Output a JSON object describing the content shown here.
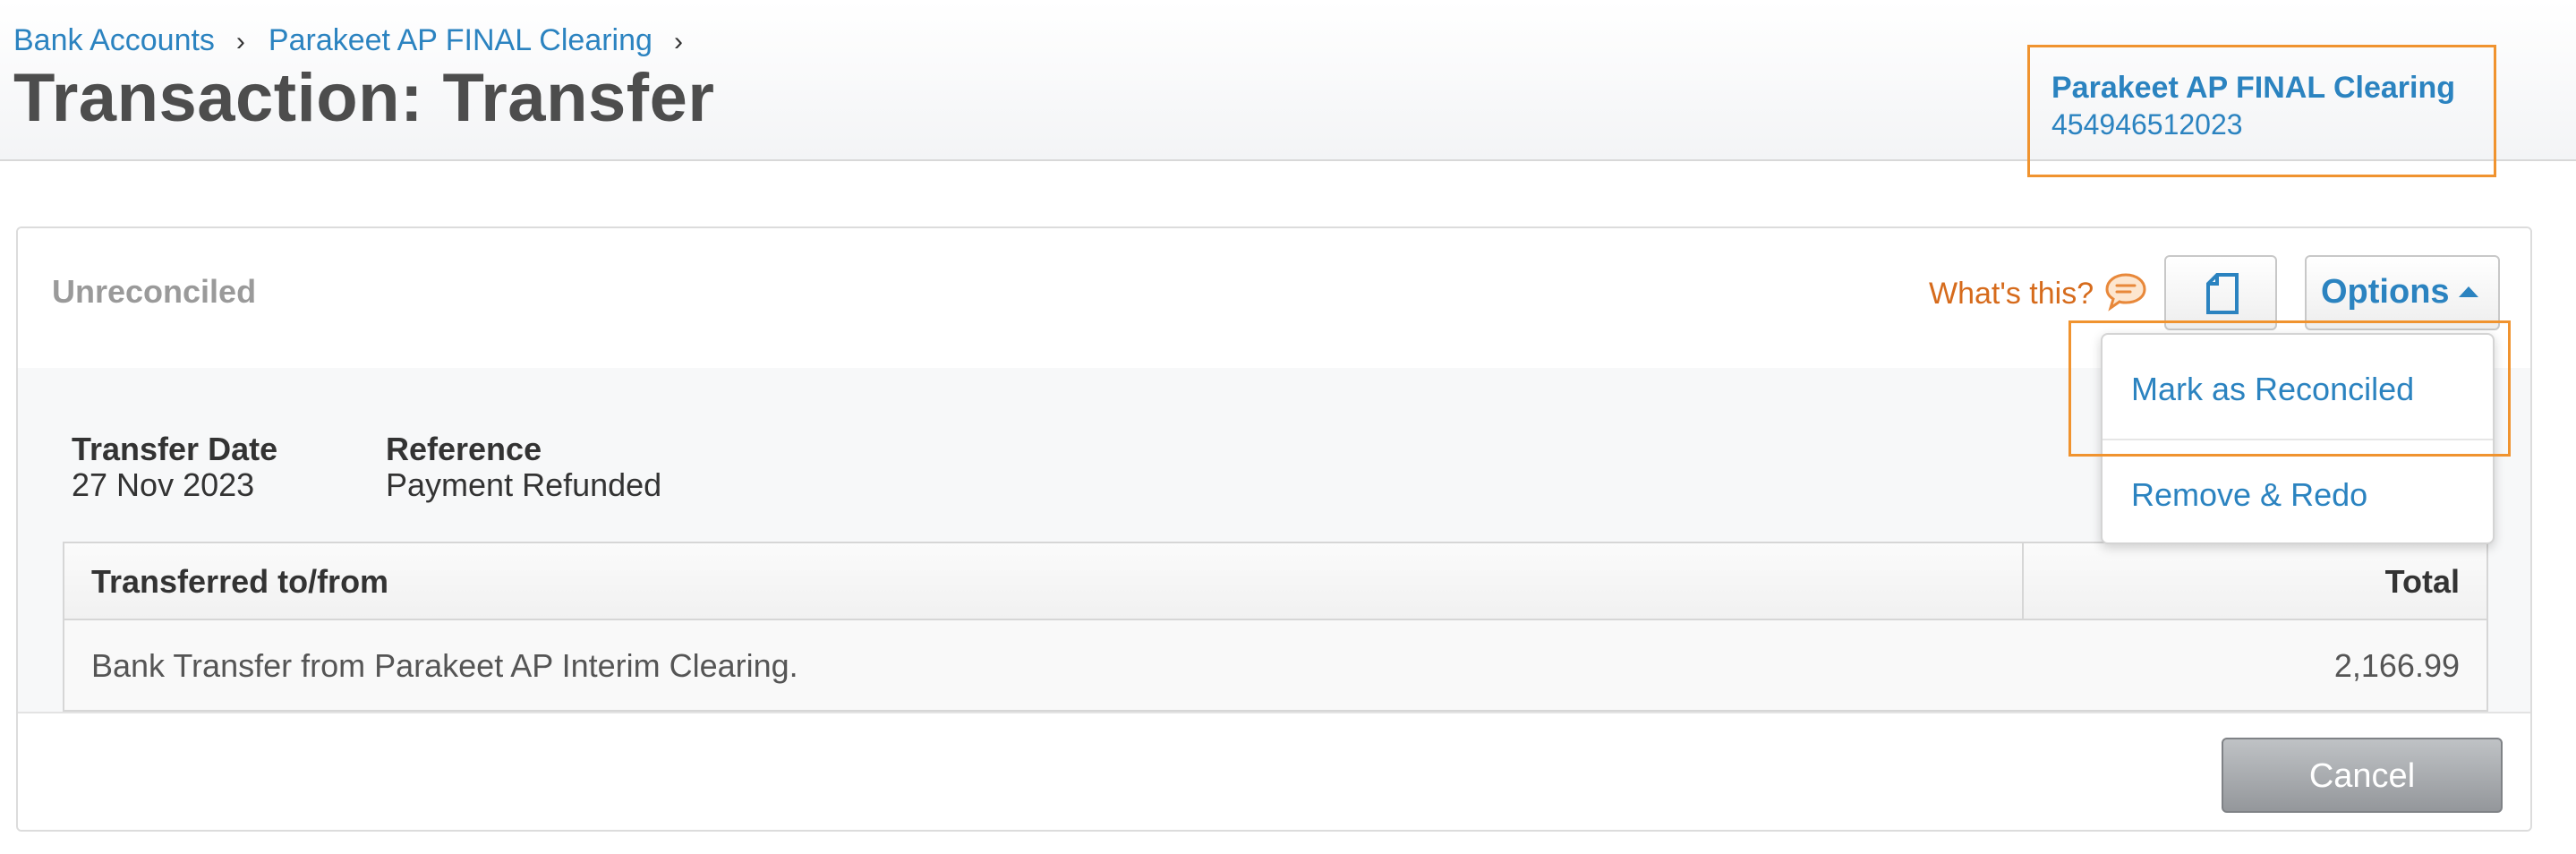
{
  "breadcrumb": {
    "items": [
      "Bank Accounts",
      "Parakeet AP FINAL Clearing"
    ],
    "separator": "›"
  },
  "page": {
    "title": "Transaction: Transfer"
  },
  "account": {
    "name": "Parakeet AP FINAL Clearing",
    "number": "454946512023"
  },
  "toolbar": {
    "status": "Unreconciled",
    "help_link": "What's this?",
    "help_icon": "speech-bubble-icon",
    "document_icon": "document-icon",
    "options_label": "Options",
    "options_icon": "caret-up-icon"
  },
  "options_menu": {
    "items": [
      "Mark as Reconciled",
      "Remove & Redo"
    ]
  },
  "details": {
    "transfer_date_label": "Transfer Date",
    "transfer_date_value": "27 Nov 2023",
    "reference_label": "Reference",
    "reference_value": "Payment Refunded"
  },
  "table": {
    "columns": [
      "Transferred to/from",
      "Total"
    ],
    "rows": [
      [
        "Bank Transfer from Parakeet AP Interim Clearing.",
        "2,166.99"
      ]
    ]
  },
  "footer": {
    "cancel_label": "Cancel"
  },
  "colors": {
    "link": "#2b83c0",
    "highlight": "#f0932f",
    "help": "#d66b1c"
  }
}
